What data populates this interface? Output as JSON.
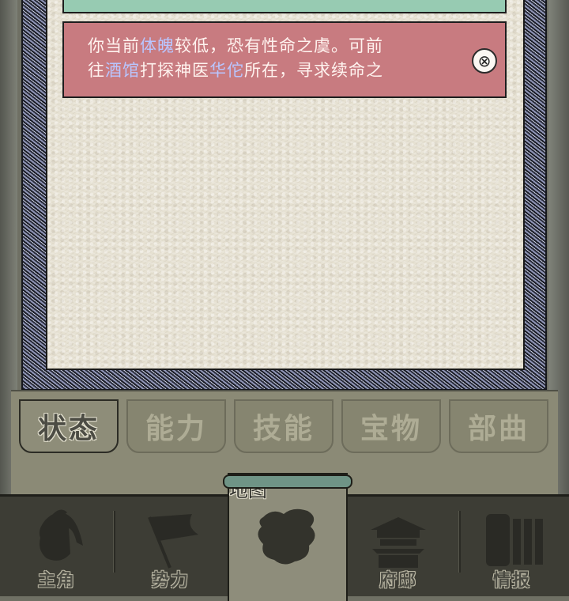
{
  "notice": {
    "line1_a": "你当前",
    "line1_hl": "体魄",
    "line1_b": "较低，恐有性命之虞。可前",
    "line2_a": "往",
    "line2_hl1": "酒馆",
    "line2_b": "打探神医",
    "line2_hl2": "华佗",
    "line2_c": "所在，寻求续命之",
    "close_glyph": "⊗"
  },
  "tabs": [
    {
      "label": "状态",
      "active": true
    },
    {
      "label": "能力",
      "active": false
    },
    {
      "label": "技能",
      "active": false
    },
    {
      "label": "宝物",
      "active": false
    },
    {
      "label": "部曲",
      "active": false
    }
  ],
  "nav": [
    {
      "label": "主角",
      "icon": "warrior-icon"
    },
    {
      "label": "势力",
      "icon": "flag-icon"
    },
    {
      "label": "地图",
      "icon": "map-icon",
      "active": true
    },
    {
      "label": "府邸",
      "icon": "mansion-icon"
    },
    {
      "label": "情报",
      "icon": "scroll-icon"
    }
  ],
  "colors": {
    "notice_bg": "#c87b80",
    "highlight": "#b9c6ff",
    "teal_bar": "#97cbb2"
  }
}
